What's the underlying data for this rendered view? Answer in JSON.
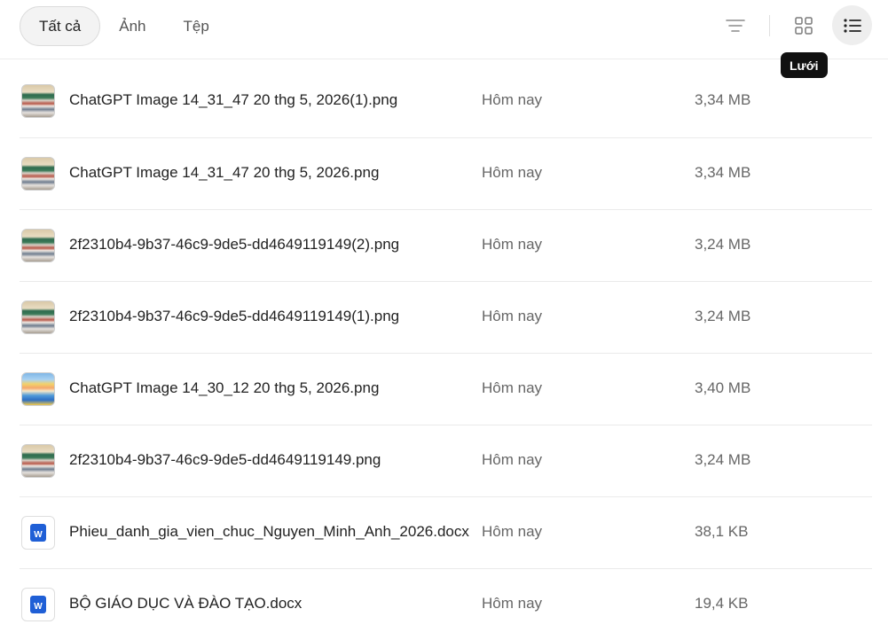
{
  "tabs": [
    {
      "label": "Tất cả",
      "active": true
    },
    {
      "label": "Ảnh",
      "active": false
    },
    {
      "label": "Tệp",
      "active": false
    }
  ],
  "toolbar": {
    "filter_icon": "filter-lines-icon",
    "grid_icon": "grid-view-icon",
    "list_icon": "list-view-icon",
    "tooltip": "Lưới"
  },
  "files": [
    {
      "name": "ChatGPT Image 14_31_47 20 thg 5, 2026(1).png",
      "date": "Hôm nay",
      "size": "3,34 MB",
      "thumb": "photo"
    },
    {
      "name": "ChatGPT Image 14_31_47 20 thg 5, 2026.png",
      "date": "Hôm nay",
      "size": "3,34 MB",
      "thumb": "photo"
    },
    {
      "name": "2f2310b4-9b37-46c9-9de5-dd4649119149(2).png",
      "date": "Hôm nay",
      "size": "3,24 MB",
      "thumb": "photo"
    },
    {
      "name": "2f2310b4-9b37-46c9-9de5-dd4649119149(1).png",
      "date": "Hôm nay",
      "size": "3,24 MB",
      "thumb": "photo"
    },
    {
      "name": "ChatGPT Image 14_30_12 20 thg 5, 2026.png",
      "date": "Hôm nay",
      "size": "3,40 MB",
      "thumb": "photo2"
    },
    {
      "name": "2f2310b4-9b37-46c9-9de5-dd4649119149.png",
      "date": "Hôm nay",
      "size": "3,24 MB",
      "thumb": "photo"
    },
    {
      "name": "Phieu_danh_gia_vien_chuc_Nguyen_Minh_Anh_2026.docx",
      "date": "Hôm nay",
      "size": "38,1 KB",
      "thumb": "doc"
    },
    {
      "name": "BỘ GIÁO DỤC VÀ ĐÀO TẠO.docx",
      "date": "Hôm nay",
      "size": "19,4 KB",
      "thumb": "doc"
    }
  ],
  "word_badge_letter": "W"
}
